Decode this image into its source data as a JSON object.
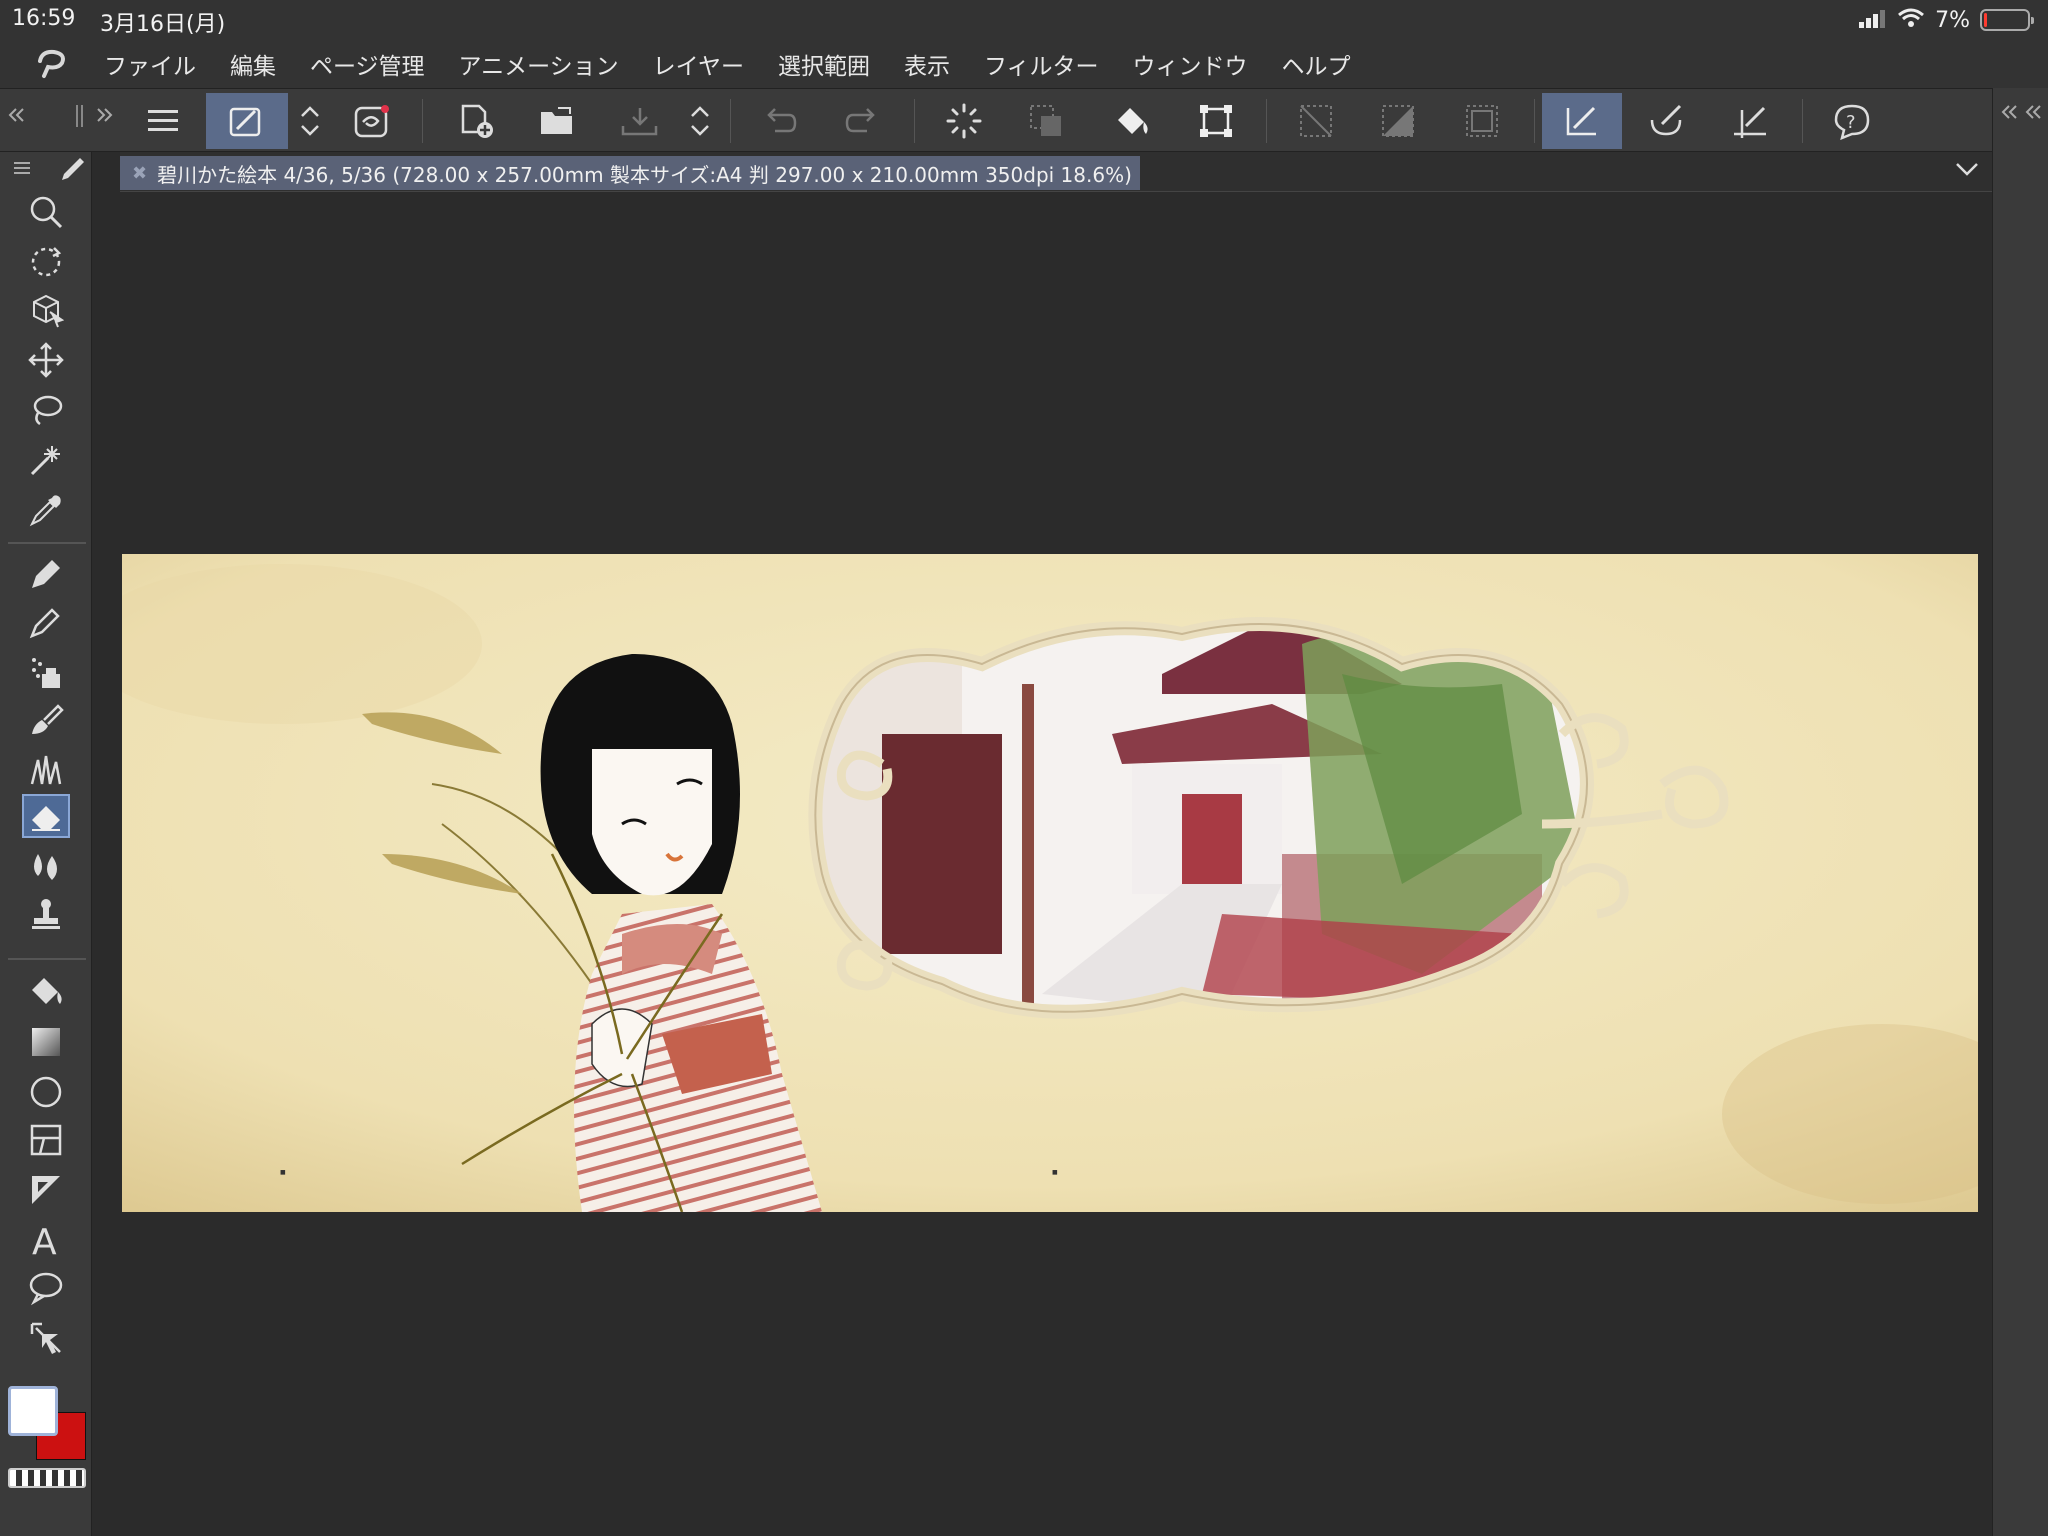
{
  "status_bar": {
    "time": "16:59",
    "date": "3月16日(月)",
    "battery_percent": "7%",
    "battery_level": 0.07,
    "battery_color": "#ff3b30"
  },
  "menu": {
    "items": [
      {
        "label": "ファイル"
      },
      {
        "label": "編集"
      },
      {
        "label": "ページ管理"
      },
      {
        "label": "アニメーション"
      },
      {
        "label": "レイヤー"
      },
      {
        "label": "選択範囲"
      },
      {
        "label": "表示"
      },
      {
        "label": "フィルター"
      },
      {
        "label": "ウィンドウ"
      },
      {
        "label": "ヘルプ"
      }
    ]
  },
  "document": {
    "tab_title": "碧川かた絵本 4/36, 5/36 (728.00 x 257.00mm 製本サイズ:A4 判 297.00 x 210.00mm 350dpi 18.6%)"
  },
  "colors": {
    "accent": "#5b6b8a",
    "main_color": "#ffffff",
    "sub_color": "#cc1111",
    "canvas_bg": "#2b2b2b",
    "paper": "#f1e6bd"
  },
  "palette": {
    "tools": [
      "zoom-icon",
      "rotate-icon",
      "3d-object-icon",
      "move-icon",
      "lasso-icon",
      "magic-wand-icon",
      "eyedropper-icon",
      "pen-icon",
      "pencil-icon",
      "airbrush-icon",
      "decoration-icon",
      "brush-icon",
      "eraser-icon",
      "blend-icon",
      "stamp-icon",
      "fill-icon",
      "gradient-icon",
      "ellipse-icon",
      "frame-icon",
      "ruler-icon",
      "text-icon",
      "balloon-icon",
      "operation-icon"
    ]
  }
}
